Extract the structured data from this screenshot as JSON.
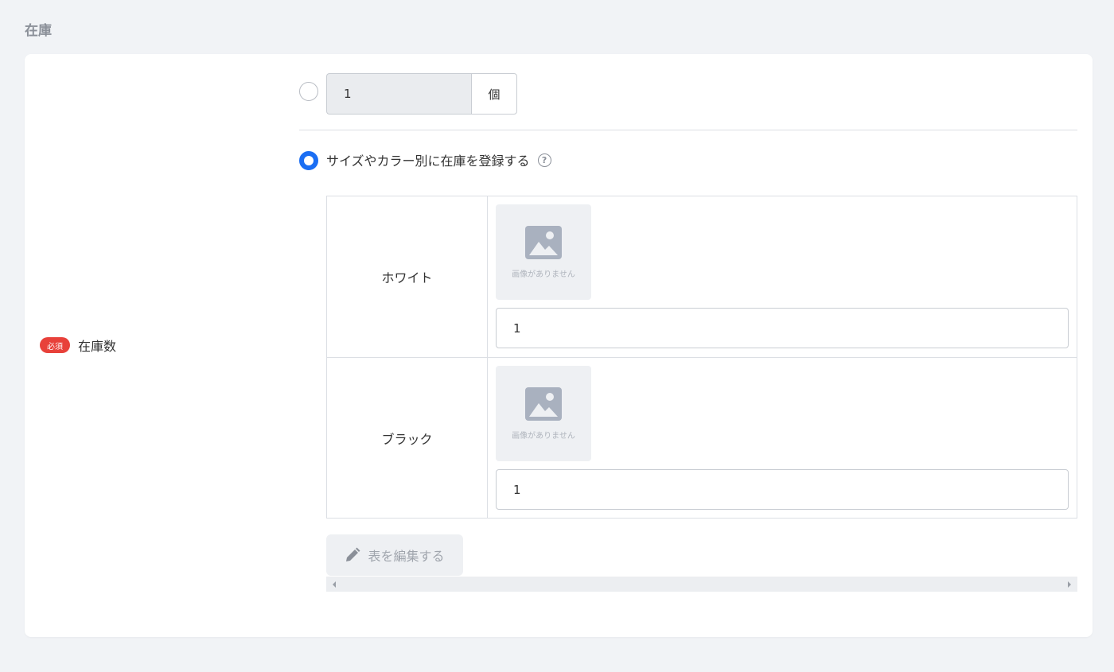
{
  "section": {
    "title": "在庫"
  },
  "field": {
    "required_badge": "必須",
    "label": "在庫数"
  },
  "simple_stock": {
    "value": "1",
    "unit": "個",
    "selected": false
  },
  "variant_option": {
    "label": "サイズやカラー別に在庫を登録する",
    "selected": true,
    "help_icon": "question-circle-icon"
  },
  "variants": [
    {
      "name": "ホワイト",
      "no_image_text": "画像がありません",
      "stock": "1"
    },
    {
      "name": "ブラック",
      "no_image_text": "画像がありません",
      "stock": "1"
    }
  ],
  "edit_table_button": {
    "label": "表を編集する",
    "icon": "pencil-icon"
  },
  "colors": {
    "accent": "#1b6ef3",
    "required": "#e8413a",
    "background": "#f1f3f6"
  }
}
